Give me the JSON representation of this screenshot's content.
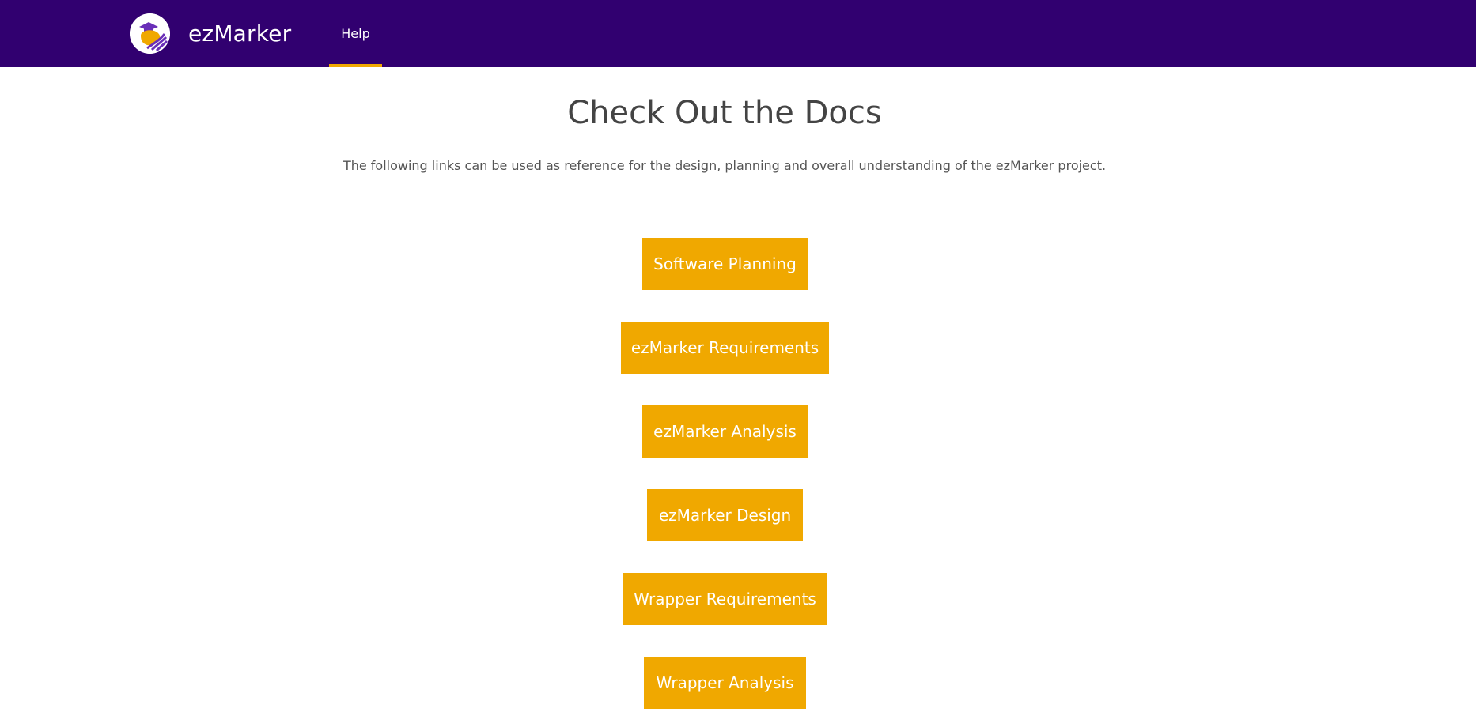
{
  "navbar": {
    "brand": "ezMarker",
    "logo_icon": "graduate-owl-logo-icon",
    "items": [
      {
        "label": "Help",
        "active": true
      }
    ],
    "colors": {
      "background": "#310070",
      "accent": "#f0a800"
    }
  },
  "main": {
    "title": "Check Out the Docs",
    "subtitle": "The following links can be used as reference for the design, planning and overall understanding of the ezMarker project.",
    "buttons": [
      {
        "label": "Software Planning"
      },
      {
        "label": "ezMarker Requirements"
      },
      {
        "label": "ezMarker Analysis"
      },
      {
        "label": "ezMarker Design"
      },
      {
        "label": "Wrapper Requirements"
      },
      {
        "label": "Wrapper Analysis"
      }
    ],
    "button_color": "#f0a800"
  }
}
